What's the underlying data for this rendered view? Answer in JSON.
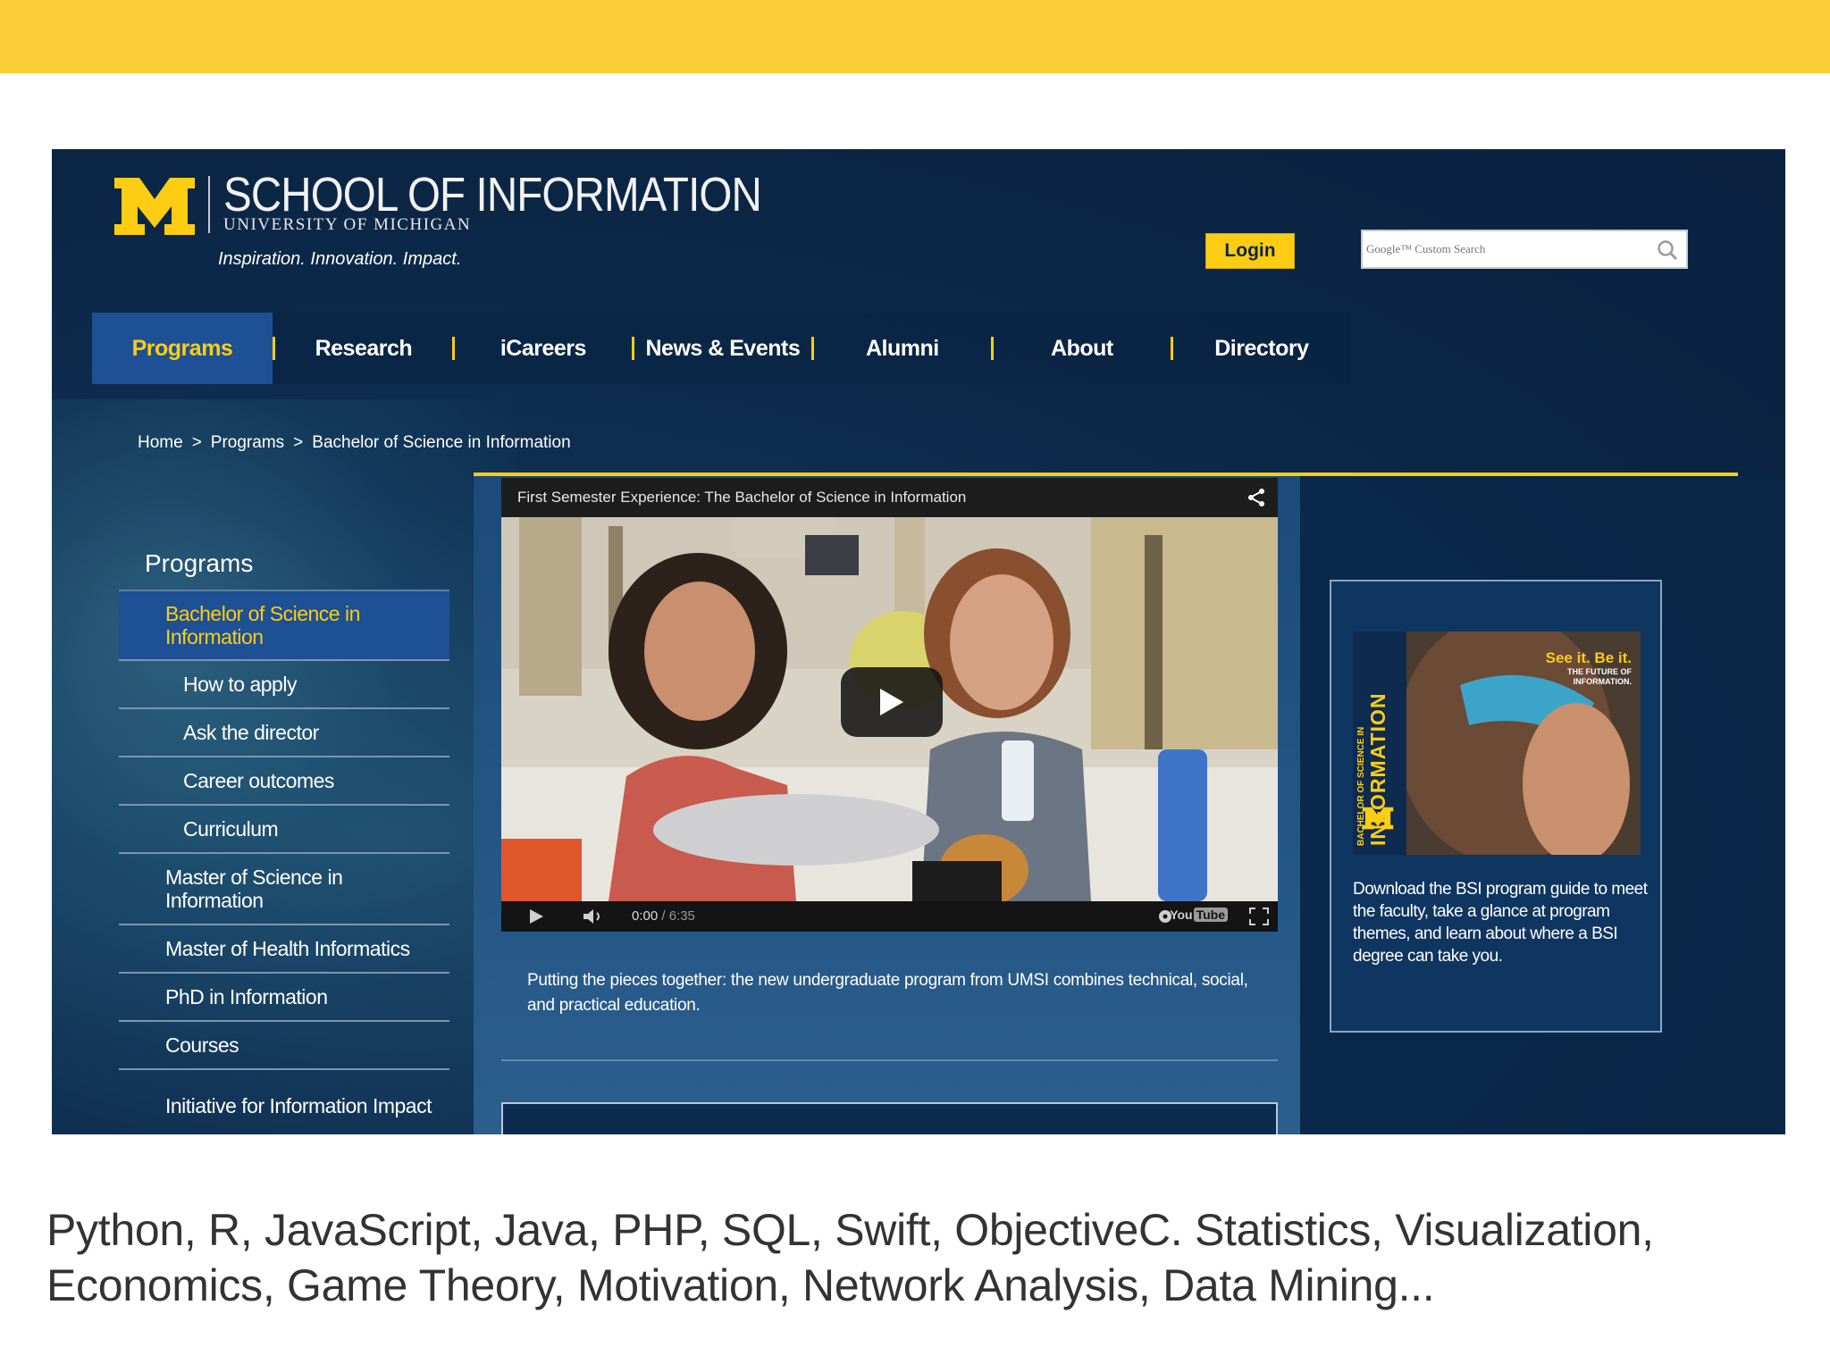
{
  "colors": {
    "band": "#fccd36",
    "navy": "#0b2544",
    "maize": "#fccd12",
    "active_blue": "#1e5095"
  },
  "header": {
    "logo_letter": "M",
    "title": "SCHOOL OF INFORMATION",
    "subtitle": "UNIVERSITY OF MICHIGAN",
    "tagline": "Inspiration. Innovation. Impact.",
    "login_label": "Login",
    "search_placeholder": "Google™ Custom Search",
    "search_icon": "search-icon"
  },
  "nav": {
    "items": [
      {
        "label": "Programs"
      },
      {
        "label": "Research"
      },
      {
        "label": "iCareers"
      },
      {
        "label": "News & Events"
      },
      {
        "label": "Alumni"
      },
      {
        "label": "About"
      },
      {
        "label": "Directory"
      }
    ]
  },
  "breadcrumb": {
    "items": [
      "Home",
      "Programs",
      "Bachelor of Science in Information"
    ],
    "separator": ">"
  },
  "sidebar": {
    "heading": "Programs",
    "items": [
      {
        "label": "Bachelor of Science in Information"
      },
      {
        "label": "How to apply"
      },
      {
        "label": "Ask the director"
      },
      {
        "label": "Career outcomes"
      },
      {
        "label": "Curriculum"
      },
      {
        "label": "Master of Science in Information"
      },
      {
        "label": "Master of Health Informatics"
      },
      {
        "label": "PhD in Information"
      },
      {
        "label": "Courses"
      },
      {
        "label": "Initiative for Information Impact"
      }
    ]
  },
  "video": {
    "title": "First Semester Experience: The Bachelor of Science in Information",
    "time_current": "0:00",
    "time_total": "/ 6:35",
    "brand": "You",
    "brand_box": "Tube",
    "caption": "Putting the pieces together: the new undergraduate program from UMSI combines technical, social, and practical education."
  },
  "promo": {
    "vertical_small": "BACHELOR OF SCIENCE IN",
    "vertical_big": "INFORMATION",
    "tagline": "See it. Be it.",
    "tagline_sub1": "THE FUTURE OF",
    "tagline_sub2": "INFORMATION.",
    "text": "Download the BSI program guide to meet the faculty, take a glance at program themes, and learn about where a BSI degree can take you."
  },
  "slide_text": {
    "line": "Python, R, JavaScript, Java, PHP, SQL, Swift, ObjectiveC.  Statistics, Visualization, Economics, Game Theory, Motivation, Network Analysis, Data Mining..."
  }
}
